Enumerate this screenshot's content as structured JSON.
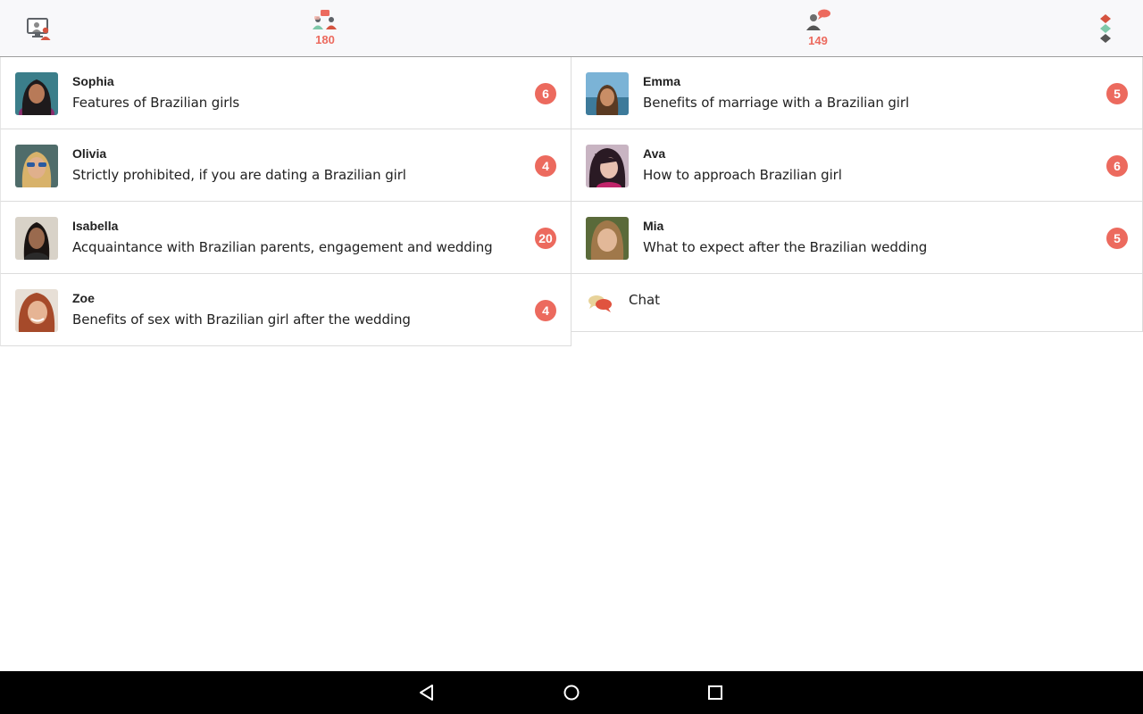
{
  "topbar": {
    "people_count": "180",
    "person_count": "149",
    "accent": "#ec6a5e"
  },
  "left_items": [
    {
      "name": "Sophia",
      "title": "Features of Brazilian girls",
      "badge": "6"
    },
    {
      "name": "Olivia",
      "title": "Strictly prohibited, if you are dating a Brazilian girl",
      "badge": "4"
    },
    {
      "name": "Isabella",
      "title": "Acquaintance with Brazilian parents, engagement and wedding",
      "badge": "20"
    },
    {
      "name": "Zoe",
      "title": "Benefits of sex with Brazilian girl after the wedding",
      "badge": "4"
    }
  ],
  "right_items": [
    {
      "name": "Emma",
      "title": "Benefits of marriage with a Brazilian girl",
      "badge": "5"
    },
    {
      "name": "Ava",
      "title": "How to approach Brazilian girl",
      "badge": "6"
    },
    {
      "name": "Mia",
      "title": "What to expect after the Brazilian wedding",
      "badge": "5"
    }
  ],
  "chat": {
    "label": "Chat"
  },
  "icons": {
    "screen": "computer-user-icon",
    "people": "group-chat-icon",
    "person": "user-message-icon",
    "traffic": "traffic-light-menu-icon",
    "back": "back-triangle-icon",
    "home": "home-circle-icon",
    "recent": "recent-square-icon"
  }
}
